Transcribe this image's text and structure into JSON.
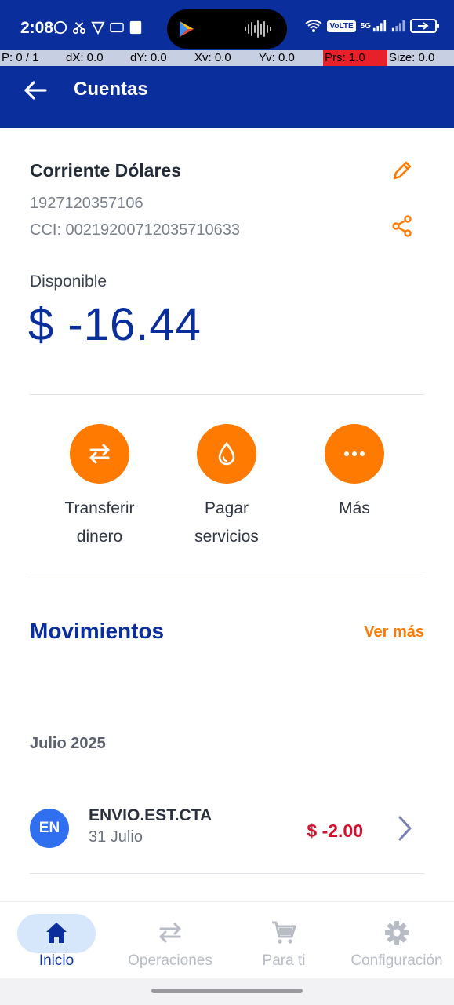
{
  "status_bar": {
    "time": "2:08",
    "network_badge": "VoLTE",
    "network_type": "5G"
  },
  "debug_overlay": {
    "pointer": "P: 0 / 1",
    "dx": "dX: 0.0",
    "dy": "dY: 0.0",
    "xv": "Xv: 0.0",
    "yv": "Yv: 0.0",
    "prs": "Prs: 1.0",
    "size": "Size: 0.0"
  },
  "app_bar": {
    "title": "Cuentas"
  },
  "account": {
    "name": "Corriente Dólares",
    "number": "1927120357106",
    "cci": "CCI: 00219200712035710633",
    "available_label": "Disponible",
    "available_amount": "$ -16.44"
  },
  "actions": [
    {
      "line1": "Transferir",
      "line2": "dinero",
      "icon": "transfer-icon"
    },
    {
      "line1": "Pagar",
      "line2": "servicios",
      "icon": "water-drop-icon"
    },
    {
      "line1": "Más",
      "line2": "",
      "icon": "more-dots-icon"
    }
  ],
  "movements": {
    "title": "Movimientos",
    "see_more": "Ver más",
    "month": "Julio 2025",
    "items": [
      {
        "initials": "EN",
        "title": "ENVIO.EST.CTA",
        "date": "31 Julio",
        "amount": "$ -2.00"
      }
    ]
  },
  "bottom_nav": [
    {
      "label": "Inicio",
      "icon": "home-icon",
      "active": true
    },
    {
      "label": "Operaciones",
      "icon": "transfer-icon",
      "active": false
    },
    {
      "label": "Para ti",
      "icon": "cart-icon",
      "active": false
    },
    {
      "label": "Configuración",
      "icon": "gear-icon",
      "active": false
    }
  ],
  "colors": {
    "brand_blue": "#0a2f9c",
    "accent_orange": "#ff7a00",
    "negative_red": "#d2112f",
    "avatar_blue": "#2f6ff0",
    "nav_active_bg": "#d6e6fb"
  }
}
